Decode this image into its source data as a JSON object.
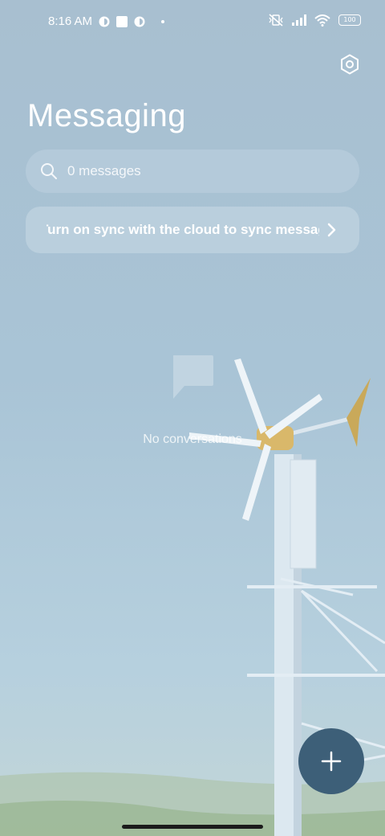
{
  "status_bar": {
    "time": "8:16 AM",
    "battery_label": "100",
    "icons": [
      "notification-icon",
      "square-icon",
      "notification-icon",
      "dot",
      "vibrate-off-icon",
      "signal-icon",
      "wifi-icon",
      "battery-icon"
    ]
  },
  "header": {
    "title": "Messaging",
    "settings_icon": "settings-hex-icon"
  },
  "search": {
    "placeholder": "0 messages",
    "icon": "search-icon"
  },
  "sync_banner": {
    "text": "Turn on sync with the cloud to sync messages",
    "chevron_icon": "chevron-right-icon"
  },
  "empty_state": {
    "icon": "chat-bubble-icon",
    "text": "No conversations"
  },
  "fab": {
    "icon": "plus-icon"
  },
  "colors": {
    "fab_background": "#3d5f78",
    "text": "#ffffff"
  }
}
